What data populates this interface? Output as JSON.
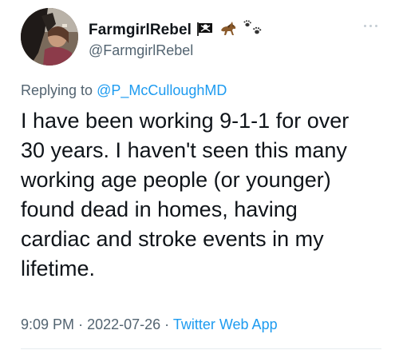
{
  "author": {
    "display_name": "FarmgirlRebel",
    "handle": "@FarmgirlRebel",
    "avatar_icon": "profile-photo-horse",
    "name_emojis": [
      "pirate-flag-icon",
      "horse-icon",
      "paw-prints-icon"
    ]
  },
  "reply": {
    "prefix": "Replying to",
    "mention": "@P_McCulloughMD"
  },
  "tweet": {
    "lines": [
      "I have been working 9-1-1 for over",
      "30 years. I haven't seen this many",
      "working age people (or younger)",
      "found dead in homes, having",
      "cardiac and stroke events in my",
      "lifetime."
    ]
  },
  "meta": {
    "time": "9:09 PM",
    "separator": "·",
    "date": "2022-07-26",
    "source": "Twitter Web App"
  },
  "colors": {
    "text": "#0f1419",
    "secondary": "#536471",
    "accent": "#1d9bf0"
  }
}
